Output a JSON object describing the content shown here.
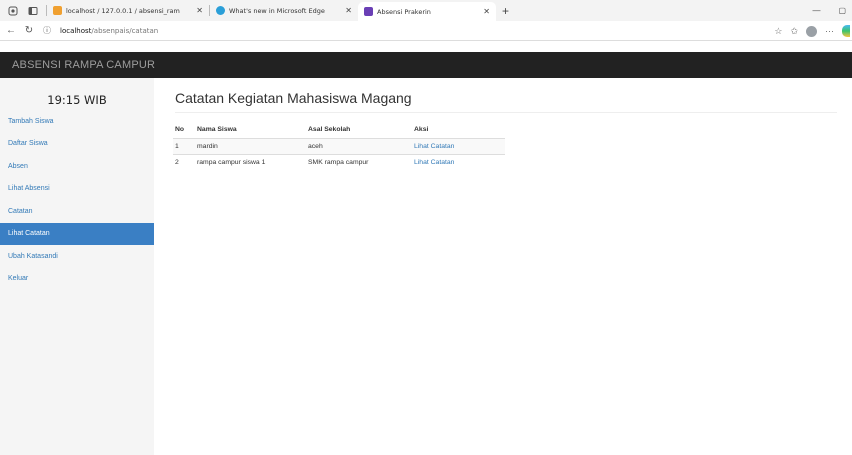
{
  "browser": {
    "tabs": [
      {
        "title": "localhost / 127.0.0.1 / absensi_ram",
        "active": false,
        "color": "#f0a030"
      },
      {
        "title": "What's new in Microsoft Edge",
        "active": false,
        "color": "#2b9fd8"
      },
      {
        "title": "Absensi Prakerin",
        "active": true,
        "color": "#6a3fb5"
      }
    ],
    "url_host": "localhost",
    "url_path": "/absenpais/catatan"
  },
  "app": {
    "brand": "ABSENSI RAMPA CAMPUR",
    "clock": "19:15 WIB"
  },
  "sidebar": {
    "items": [
      {
        "label": "Tambah Siswa",
        "active": false
      },
      {
        "label": "Daftar Siswa",
        "active": false
      },
      {
        "label": "Absen",
        "active": false
      },
      {
        "label": "Lihat Absensi",
        "active": false
      },
      {
        "label": "Catatan",
        "active": false
      },
      {
        "label": "Lihat Catatan",
        "active": true
      },
      {
        "label": "Ubah Katasandi",
        "active": false
      },
      {
        "label": "Keluar",
        "active": false
      }
    ]
  },
  "main": {
    "title": "Catatan Kegiatan Mahasiswa Magang",
    "table": {
      "headers": [
        "No",
        "Nama Siswa",
        "Asal Sekolah",
        "Aksi"
      ],
      "rows": [
        {
          "no": "1",
          "nama": "mardin",
          "sekolah": "aceh",
          "aksi": "Lihat Catatan"
        },
        {
          "no": "2",
          "nama": "rampa campur siswa 1",
          "sekolah": "SMK rampa campur",
          "aksi": "Lihat Catatan"
        }
      ]
    }
  },
  "colors": {
    "navbar": "#222222",
    "sidebar_active": "#3a7fc4",
    "link": "#337ab7"
  }
}
